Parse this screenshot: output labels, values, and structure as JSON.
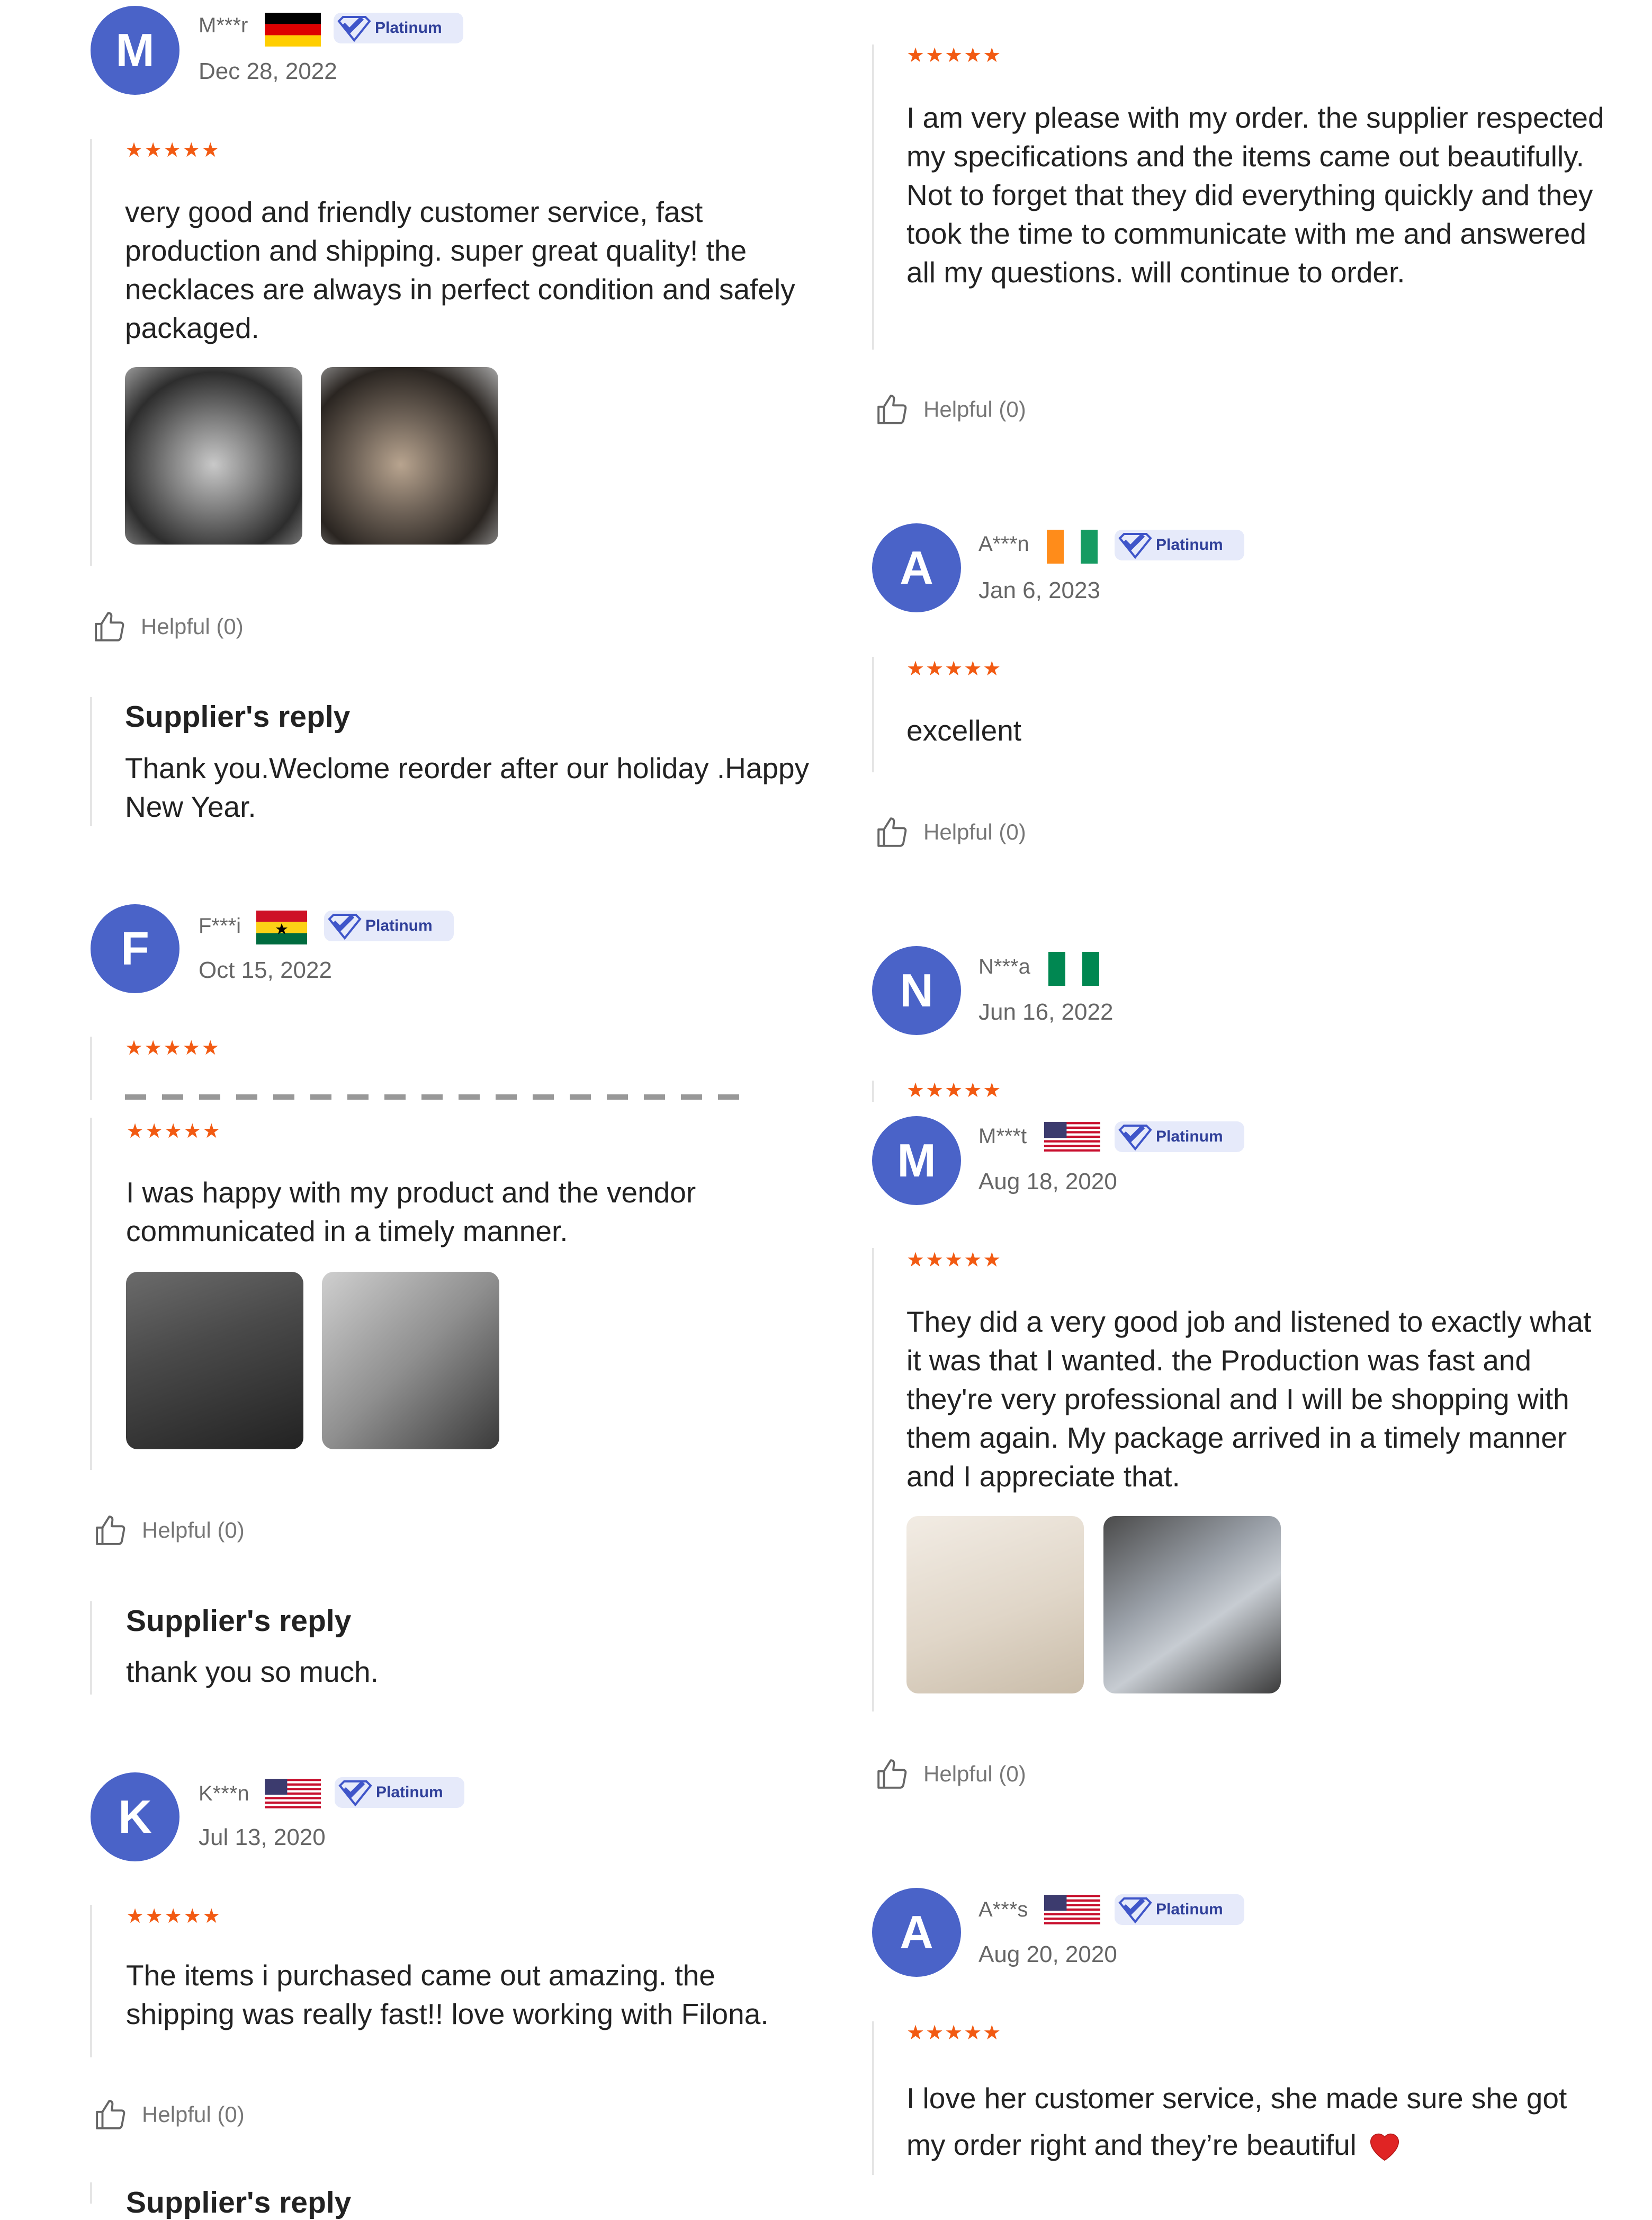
{
  "left_column": {
    "review1": {
      "initial": "M",
      "name": "M***r",
      "date": "Dec 28, 2022",
      "badge": "Platinum",
      "stars": "★★★★★",
      "text": "very good and friendly customer service, fast production and shipping. super great quality! the necklaces are always in perfect condition and safely packaged.",
      "helpful": "Helpful (0)",
      "reply_title": "Supplier's reply",
      "reply_text": "Thank you.Weclome reorder after our holiday .Happy New Year."
    },
    "review2": {
      "initial": "F",
      "name": "F***i",
      "date": "Oct 15, 2022",
      "badge": "Platinum",
      "stars": "★★★★★"
    },
    "review3": {
      "stars": "★★★★★",
      "text": "I was happy with my product and the vendor communicated in a timely manner.",
      "helpful": "Helpful (0)",
      "reply_title": "Supplier's reply",
      "reply_text": "thank you so much."
    },
    "review4": {
      "initial": "K",
      "name": "K***n",
      "date": "Jul 13, 2020",
      "badge": "Platinum",
      "stars": "★★★★★",
      "text": "The items i purchased came out amazing. the shipping was really fast!! love working with Filona.",
      "helpful": "Helpful (0)",
      "reply_title": "Supplier's reply"
    }
  },
  "right_column": {
    "review1": {
      "stars": "★★★★★",
      "text": "I am very please with my order. the supplier respected my specifications and the items came out beautifully. Not to forget that they did everything quickly and they took the time to communicate with me and answered all my questions. will continue to order.",
      "helpful": "Helpful (0)"
    },
    "review2": {
      "initial": "A",
      "name": "A***n",
      "date": "Jan 6, 2023",
      "badge": "Platinum",
      "stars": "★★★★★",
      "text": "excellent",
      "helpful": "Helpful (0)"
    },
    "review3": {
      "initial": "N",
      "name": "N***a",
      "date": "Jun 16, 2022",
      "stars": "★★★★★"
    },
    "review4": {
      "initial": "M",
      "name": "M***t",
      "date": "Aug 18, 2020",
      "badge": "Platinum",
      "stars": "★★★★★",
      "text": "They did a very good job and listened to exactly what it was that I wanted. the Production was fast and they're very professional and I will be shopping with them again. My package arrived in a timely manner and I appreciate that.",
      "helpful": "Helpful (0)"
    },
    "review5": {
      "initial": "A",
      "name": "A***s",
      "date": "Aug 20, 2020",
      "badge": "Platinum",
      "stars": "★★★★★",
      "text_line1": "I love her customer service, she made sure she got",
      "text_line2": "my order right and they’re beautiful"
    }
  },
  "colors": {
    "accent": "#4a63c8",
    "stars": "#f25a12",
    "badge_bg": "#e6eafa"
  },
  "icons": [
    "thumbs-up-icon",
    "verified-check-icon",
    "heart-icon",
    "flag-icon"
  ]
}
